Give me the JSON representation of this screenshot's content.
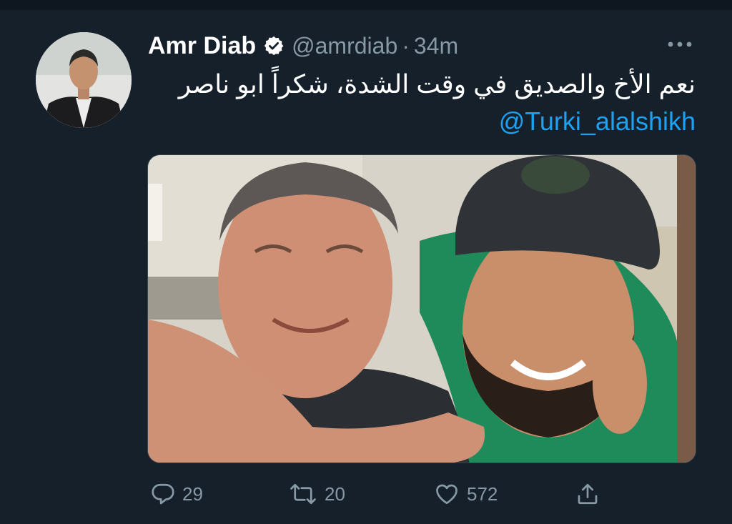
{
  "tweet": {
    "author_name": "Amr Diab",
    "handle": "@amrdiab",
    "separator": "·",
    "time": "34m",
    "text_arabic": "نعم الأخ والصديق في وقت الشدة، شكراً ابو ناصر",
    "mention": "@Turki_alalshikh"
  },
  "actions": {
    "reply_count": "29",
    "retweet_count": "20",
    "like_count": "572"
  },
  "icons": {
    "verified": "verified-badge-icon",
    "more": "more-horizontal-icon",
    "reply": "speech-bubble-icon",
    "retweet": "retweet-arrows-icon",
    "like": "heart-icon",
    "share": "share-upload-icon"
  },
  "colors": {
    "background": "#15202b",
    "primary_text": "#ffffff",
    "secondary_text": "#8899a6",
    "link": "#1da1f2",
    "border": "#38444d"
  }
}
